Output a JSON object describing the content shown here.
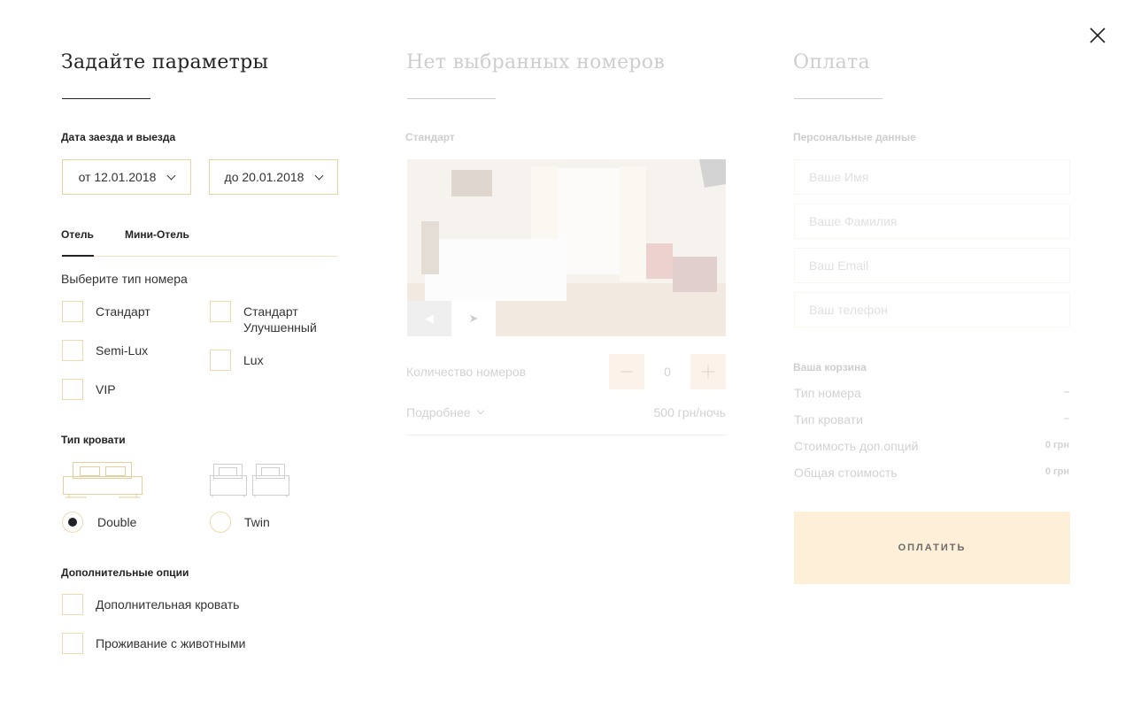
{
  "close_icon": "close-icon",
  "params": {
    "title": "Задайте параметры",
    "dates_label": "Дата заезда и выезда",
    "date_from": "от 12.01.2018",
    "date_to": "до 20.01.2018",
    "tabs": [
      {
        "label": "Отель",
        "active": true
      },
      {
        "label": "Мини-Отель",
        "active": false
      }
    ],
    "room_type_prompt": "Выберите тип номера",
    "room_types": [
      {
        "label": "Стандарт",
        "checked": false
      },
      {
        "label": "Semi-Lux",
        "checked": false
      },
      {
        "label": "VIP",
        "checked": false
      },
      {
        "label": "Стандарт Улучшенный",
        "checked": false
      },
      {
        "label": "Lux",
        "checked": false
      }
    ],
    "bed_type_label": "Тип кровати",
    "bed_types": [
      {
        "label": "Double",
        "selected": true
      },
      {
        "label": "Twin",
        "selected": false
      }
    ],
    "extras_label": "Дополнительные опции",
    "extras": [
      {
        "label": "Дополнительная кровать",
        "checked": false
      },
      {
        "label": "Проживание с животными",
        "checked": false
      }
    ]
  },
  "rooms": {
    "title": "Нет выбранных номеров",
    "room_name": "Стандарт",
    "quantity_label": "Количество номеров",
    "quantity": "0",
    "details_link": "Подробнее",
    "price": "500 грн/ночь"
  },
  "payment": {
    "title": "Оплата",
    "personal_label": "Персональные данные",
    "fields": {
      "first_name_placeholder": "Ваше Имя",
      "last_name_placeholder": "Ваше Фамилия",
      "email_placeholder": "Ваш Email",
      "phone_placeholder": "Ваш телефон"
    },
    "cart_label": "Ваша корзина",
    "cart": [
      {
        "label": "Тип номера",
        "value": "–"
      },
      {
        "label": "Тип кровати",
        "value": "–"
      },
      {
        "label": "Стоимость доп.опций",
        "value": "0 грн"
      },
      {
        "label": "Общая стоимость",
        "value": "0 грн"
      }
    ],
    "pay_button": "ОПЛАТИТЬ"
  },
  "colors": {
    "accent_border": "#e6d3a3",
    "pay_button_bg": "#fdefd8",
    "qty_button_bg": "#f2c9a1",
    "text": "#222222"
  }
}
